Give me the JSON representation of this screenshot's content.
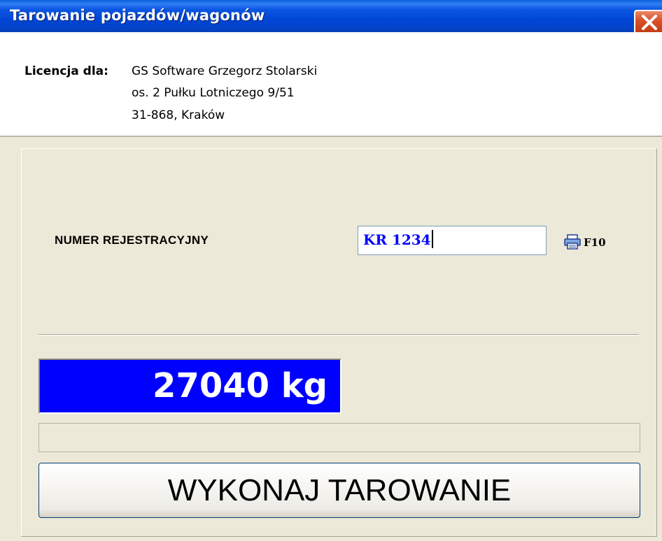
{
  "window": {
    "title": "Tarowanie pojazdów/wagonów"
  },
  "license": {
    "label": "Licencja dla:",
    "lines": [
      "GS Software Grzegorz Stolarski",
      "os. 2 Pułku Lotniczego 9/51",
      "31-868, Kraków"
    ]
  },
  "form": {
    "plate_label": "NUMER REJESTRACYJNY",
    "plate_value": "KR 1234",
    "print_shortcut": "F10",
    "print_icon": "printer-icon"
  },
  "scale": {
    "weight": "27040 kg",
    "progress_fraction": 0
  },
  "actions": {
    "tare_label": "WYKONAJ TAROWANIE"
  },
  "colors": {
    "title_bar": "#0046d5",
    "weight_bg": "#0000ff",
    "weight_text": "#ffffff",
    "plate_text": "#0000ff"
  }
}
